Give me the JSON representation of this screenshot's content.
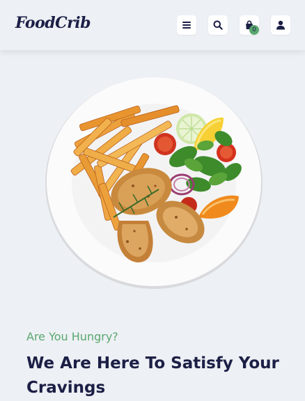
{
  "header": {
    "logo": "FoodCrib",
    "cart_count": "0",
    "icons": [
      "menu-icon",
      "search-icon",
      "shopping-bag-icon",
      "user-icon"
    ]
  },
  "hero": {
    "image": "plate-of-chicken-fries-salad",
    "subtitle": "Are You Hungry?",
    "headline": "We Are Here To Satisfy Your Cravings"
  },
  "colors": {
    "background": "#edf0f4",
    "navy": "#1c1f45",
    "accent_green": "#5aa76f"
  }
}
